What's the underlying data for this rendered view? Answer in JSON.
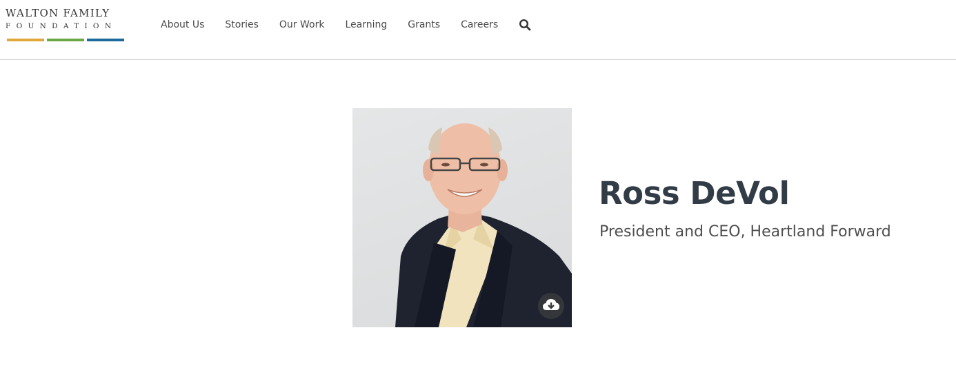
{
  "header": {
    "logo": {
      "line1": "WALTON FAMILY",
      "line2": "FOUNDATION",
      "bar_colors": [
        "#e0a83a",
        "#6aa846",
        "#1d6a9c"
      ]
    },
    "nav": {
      "items": [
        {
          "label": "About Us"
        },
        {
          "label": "Stories"
        },
        {
          "label": "Our Work"
        },
        {
          "label": "Learning"
        },
        {
          "label": "Grants"
        },
        {
          "label": "Careers"
        }
      ],
      "search_icon": "search-icon"
    }
  },
  "profile": {
    "name": "Ross DeVol",
    "title": "President and CEO, Heartland Forward",
    "download_icon": "cloud-download-icon"
  }
}
